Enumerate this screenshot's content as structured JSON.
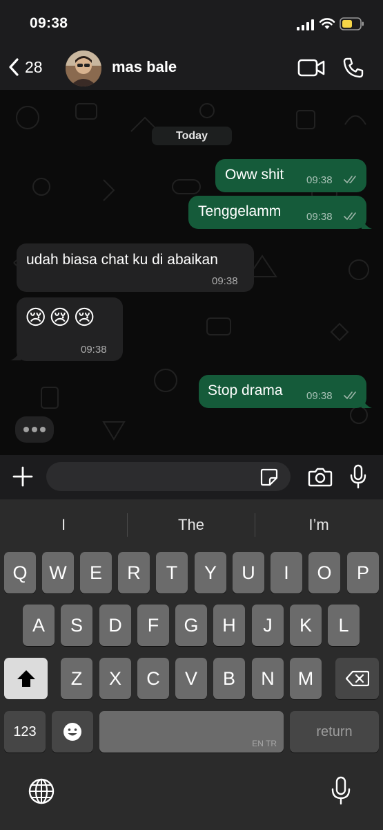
{
  "status_bar": {
    "time": "09:38",
    "battery_color": "#f5d547"
  },
  "header": {
    "back_count": "28",
    "contact_name": "mas bale"
  },
  "chat": {
    "date_label": "Today",
    "messages": [
      {
        "direction": "outgoing",
        "text": "Oww shit",
        "time": "09:38",
        "status": "read-ticks"
      },
      {
        "direction": "outgoing",
        "text": "Tenggelamm",
        "time": "09:38",
        "status": "read-ticks"
      },
      {
        "direction": "incoming",
        "text": "udah biasa chat ku di abaikan",
        "time": "09:38"
      },
      {
        "direction": "incoming",
        "text": "😢😢😢",
        "time": "09:38"
      },
      {
        "direction": "outgoing",
        "text": "Stop drama",
        "time": "09:38",
        "status": "read-ticks"
      }
    ],
    "typing_indicator": "typing-dots"
  },
  "composer": {
    "icons": [
      "plus-icon",
      "sticker-icon",
      "camera-icon",
      "microphone-icon"
    ]
  },
  "keyboard": {
    "suggestions": [
      "I",
      "The",
      "I’m"
    ],
    "row1": [
      "Q",
      "W",
      "E",
      "R",
      "T",
      "Y",
      "U",
      "I",
      "O",
      "P"
    ],
    "row2": [
      "A",
      "S",
      "D",
      "F",
      "G",
      "H",
      "J",
      "K",
      "L"
    ],
    "row3": [
      "Z",
      "X",
      "C",
      "V",
      "B",
      "N",
      "M"
    ],
    "numbers_label": "123",
    "space_language": "EN TR",
    "return_label": "return",
    "icons": [
      "shift-icon",
      "delete-icon",
      "emoji-icon",
      "globe-icon",
      "dictation-icon"
    ]
  },
  "colors": {
    "outgoing_bubble": "#155b3a",
    "incoming_bubble": "#222223",
    "key": "#6b6b6b",
    "key_dark": "#464646"
  }
}
